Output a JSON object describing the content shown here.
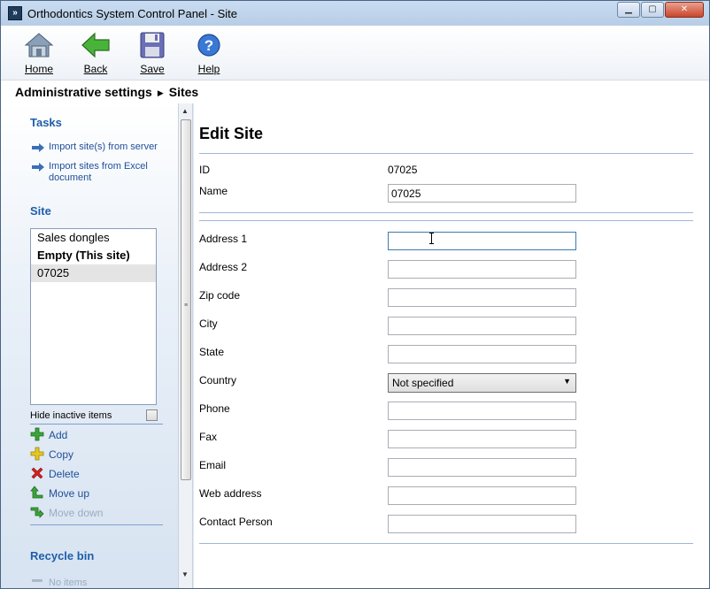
{
  "window": {
    "title": "Orthodontics System Control Panel - Site"
  },
  "toolbar": {
    "home": "Home",
    "back": "Back",
    "save": "Save",
    "help": "Help"
  },
  "breadcrumb": {
    "parent": "Administrative settings",
    "current": "Sites"
  },
  "sidebar": {
    "tasks_heading": "Tasks",
    "tasks": [
      {
        "label": "Import site(s) from server"
      },
      {
        "label": "Import sites from Excel document"
      }
    ],
    "site_heading": "Site",
    "sites": [
      {
        "label": "Sales dongles"
      },
      {
        "label": "Empty (This site)"
      },
      {
        "label": "07025"
      }
    ],
    "hide_inactive": "Hide inactive items",
    "actions": {
      "add": "Add",
      "copy": "Copy",
      "delete": "Delete",
      "move_up": "Move up",
      "move_down": "Move down"
    },
    "recycle_heading": "Recycle bin",
    "recycle_text": "No items"
  },
  "form": {
    "title": "Edit Site",
    "id_label": "ID",
    "id_value": "07025",
    "name_label": "Name",
    "name_value": "07025",
    "address1_label": "Address 1",
    "address2_label": "Address 2",
    "zip_label": "Zip code",
    "city_label": "City",
    "state_label": "State",
    "country_label": "Country",
    "country_value": "Not specified",
    "phone_label": "Phone",
    "fax_label": "Fax",
    "email_label": "Email",
    "web_label": "Web address",
    "contact_label": "Contact Person"
  },
  "colors": {
    "accent_link": "#1f4f99",
    "heading_blue": "#1e5ea8",
    "add_green": "#3aa53a",
    "copy_yellow": "#e8c81a",
    "delete_red": "#d42020"
  }
}
